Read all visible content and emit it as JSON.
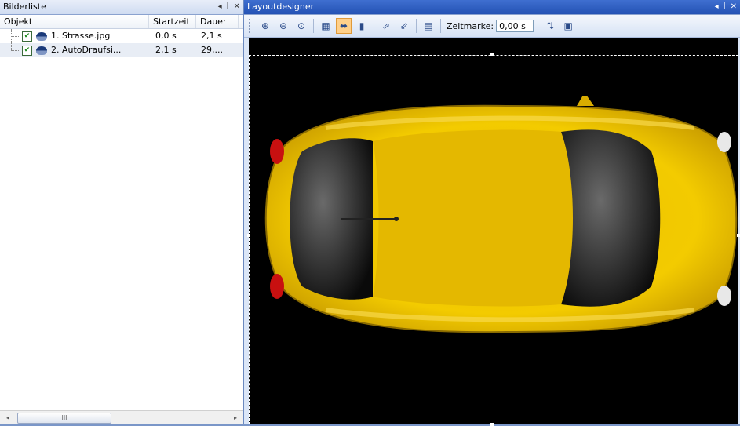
{
  "left_panel": {
    "title": "Bilderliste",
    "pin_icon": "pin-icon",
    "columns": {
      "object": "Objekt",
      "start": "Startzeit",
      "duration": "Dauer"
    },
    "rows": [
      {
        "name": "1. Strasse.jpg",
        "start": "0,0 s",
        "duration": "2,1 s",
        "checked": true
      },
      {
        "name": "2. AutoDraufsi...",
        "start": "2,1 s",
        "duration": "29,...",
        "checked": true
      }
    ],
    "scroll_thumb": "III"
  },
  "right_panel": {
    "title": "Layoutdesigner",
    "toolbar": {
      "timestamp_label": "Zeitmarke:",
      "timestamp_value": "0,00 s"
    }
  },
  "colors": {
    "active_title": "#2452b4",
    "car": "#f2c500",
    "canvas": "#000000",
    "selected_button": "#ffd08a"
  }
}
